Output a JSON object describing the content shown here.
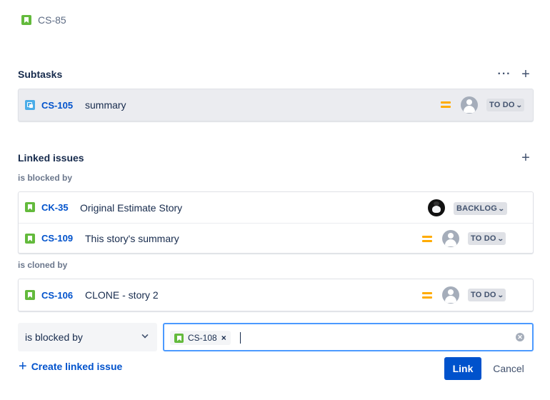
{
  "parent": {
    "key": "CS-85",
    "icon": "story-icon"
  },
  "subtasks": {
    "title": "Subtasks",
    "more_icon": "more-horizontal-icon",
    "add_icon": "plus-icon",
    "items": [
      {
        "key": "CS-105",
        "summary": "summary",
        "type_icon": "subtask-icon",
        "priority": "medium",
        "assignee": "unassigned",
        "status": "TO DO"
      }
    ]
  },
  "linked": {
    "title": "Linked issues",
    "add_icon": "plus-icon",
    "groups": [
      {
        "label": "is blocked by",
        "items": [
          {
            "key": "CK-35",
            "summary": "Original Estimate Story",
            "type_icon": "story-icon",
            "assignee": "user-photo",
            "status": "BACKLOG"
          },
          {
            "key": "CS-109",
            "summary": "This story's summary",
            "type_icon": "story-icon",
            "priority": "medium",
            "assignee": "unassigned",
            "status": "TO DO"
          }
        ]
      },
      {
        "label": "is cloned by",
        "items": [
          {
            "key": "CS-106",
            "summary": "CLONE - story 2",
            "type_icon": "story-icon",
            "priority": "medium",
            "assignee": "unassigned",
            "status": "TO DO"
          }
        ]
      }
    ]
  },
  "link_form": {
    "link_type": "is blocked by",
    "selected_issue": "CS-108",
    "remove_chip": "×",
    "clear_icon": "clear-icon"
  },
  "actions": {
    "create_linked": "Create linked issue",
    "link": "Link",
    "cancel": "Cancel"
  },
  "colors": {
    "accent": "#0052cc",
    "story": "#63ba3c",
    "subtask": "#4bade8",
    "priority_medium": "#ffab00",
    "focus": "#4c9aff"
  }
}
